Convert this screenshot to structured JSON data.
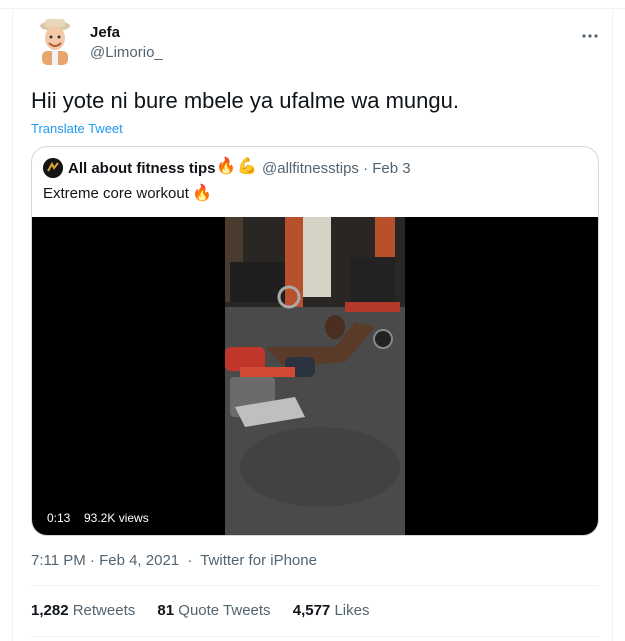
{
  "tweet": {
    "author_name": "Jefa",
    "author_handle": "@Limorio_",
    "more_icon": "more-horizontal-icon",
    "text": "Hii yote ni bure mbele ya ufalme wa mungu.",
    "translate_label": "Translate Tweet",
    "timestamp": "7:11 PM · Feb 4, 2021",
    "separator": "·",
    "source": "Twitter for iPhone"
  },
  "quote": {
    "name": "All about fitness tips",
    "name_emojis": [
      "🔥",
      "💪"
    ],
    "handle": "@allfitnesstips",
    "date": "· Feb 3",
    "text": "Extreme core workout",
    "text_emoji": "🔥",
    "video": {
      "duration": "0:13",
      "views": "93.2K views"
    }
  },
  "stats": {
    "retweets_count": "1,282",
    "retweets_label": "Retweets",
    "quotes_count": "81",
    "quotes_label": "Quote Tweets",
    "likes_count": "4,577",
    "likes_label": "Likes"
  },
  "colors": {
    "link": "#1d9bf0",
    "muted": "#536471",
    "text": "#0f1419",
    "border": "#cfd9de"
  }
}
